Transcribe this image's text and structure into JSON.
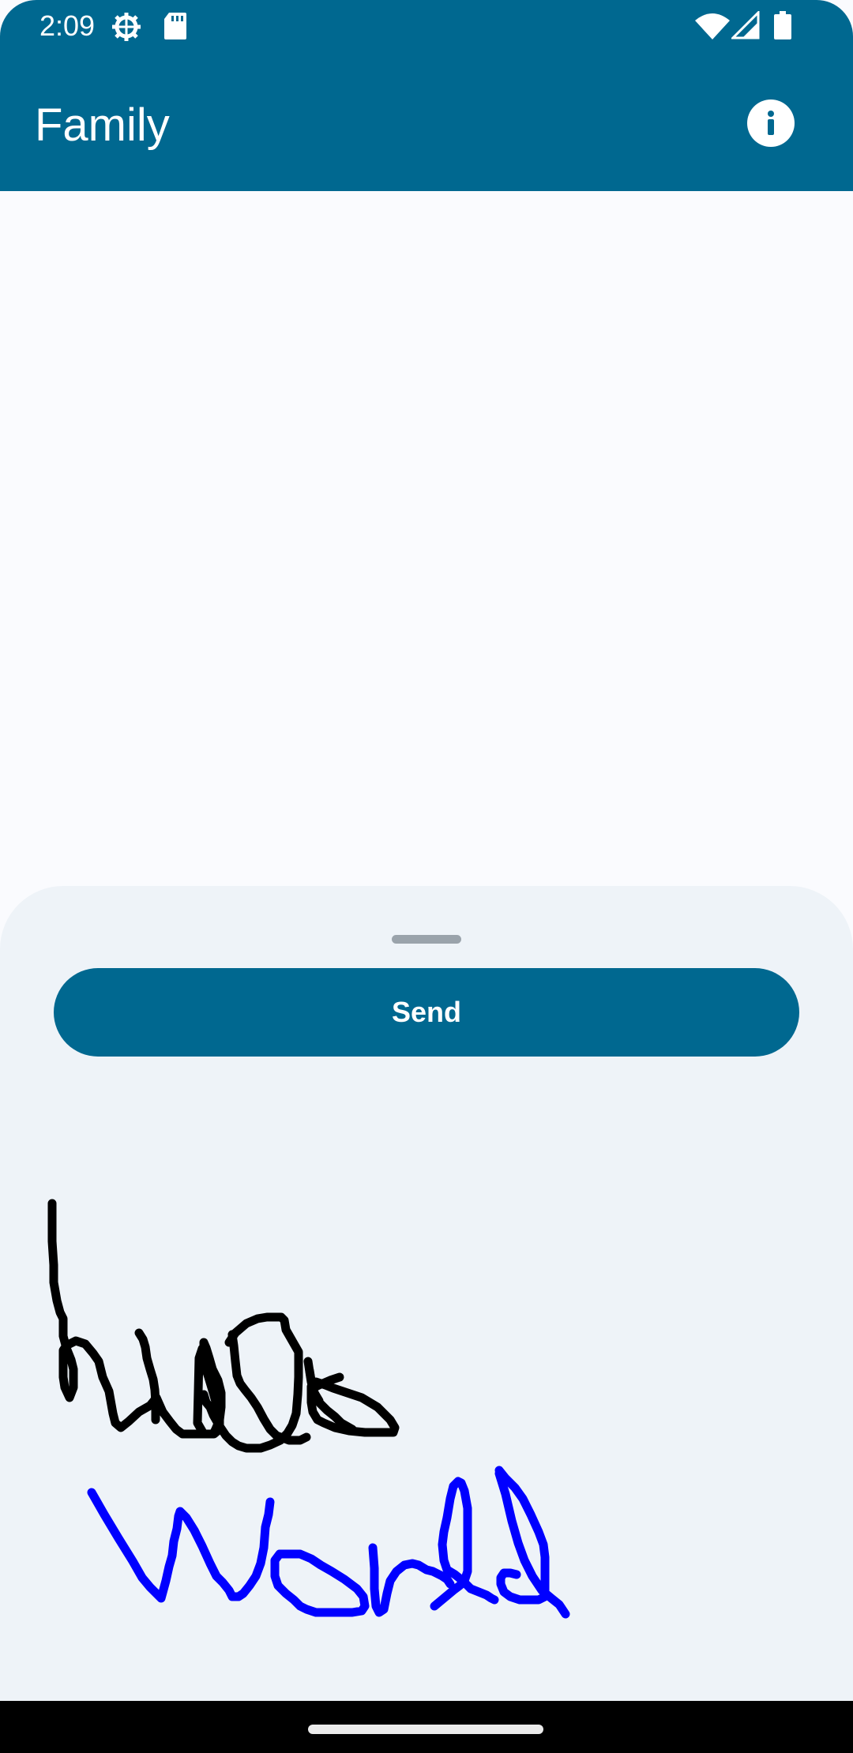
{
  "status_bar": {
    "time": "2:09",
    "icons": [
      "gear-icon",
      "sd-card-icon",
      "wifi-icon",
      "cell-signal-icon",
      "battery-icon"
    ]
  },
  "app_bar": {
    "title": "Family",
    "action_icon": "info-icon"
  },
  "bottom_sheet": {
    "send_label": "Send",
    "ink_strokes": [
      {
        "name": "hello",
        "color": "#000000"
      },
      {
        "name": "world",
        "color": "#0000ff"
      }
    ]
  },
  "colors": {
    "primary": "#006890",
    "background": "#fafbfe",
    "sheet": "#eef3f8",
    "ink_black": "#000000",
    "ink_blue": "#0000ff"
  }
}
